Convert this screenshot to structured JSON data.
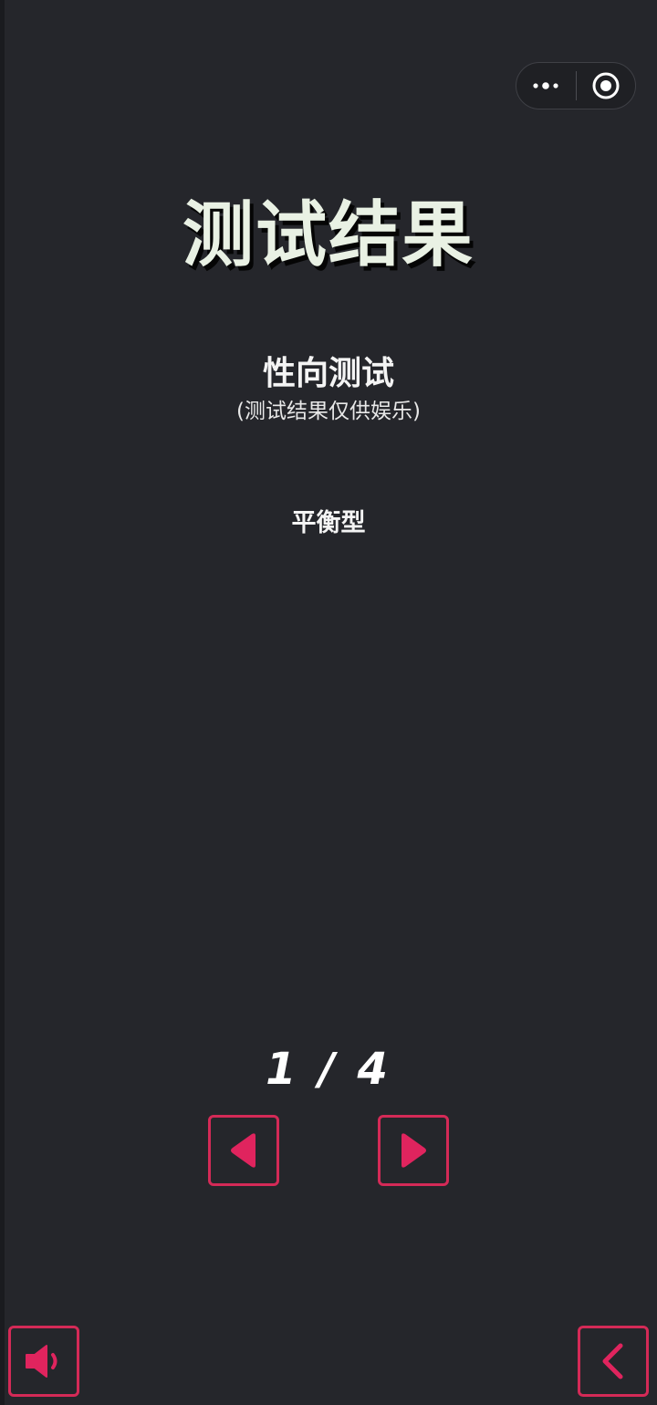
{
  "header": {
    "capsule_menu_icon": "more-dots-icon",
    "capsule_close_icon": "target-circle-icon"
  },
  "result": {
    "title": "测试结果",
    "test_name": "性向测试",
    "disclaimer": "(测试结果仅供娱乐)",
    "type": "平衡型"
  },
  "pagination": {
    "label": "1 / 4",
    "current": 1,
    "total": 4,
    "prev_icon": "triangle-left-icon",
    "next_icon": "triangle-right-icon"
  },
  "footer": {
    "sound_icon": "speaker-icon",
    "back_icon": "chevron-left-icon"
  },
  "colors": {
    "background": "#25262b",
    "accent": "#e0245e",
    "title_text": "#e9f1e4"
  }
}
